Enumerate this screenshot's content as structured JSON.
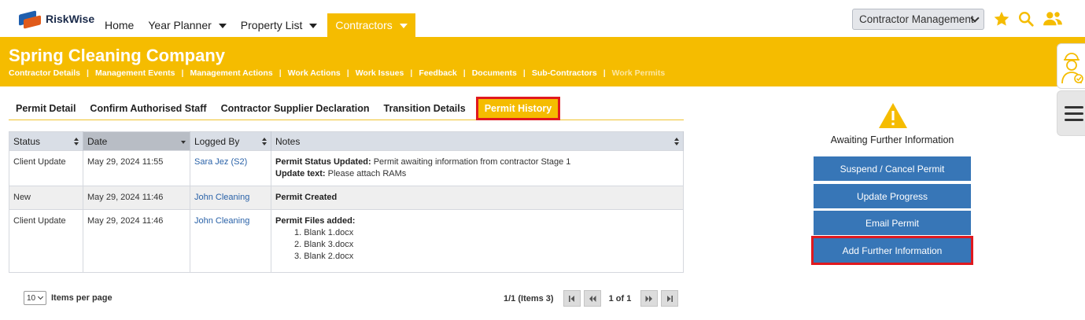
{
  "app": {
    "name": "RiskWise"
  },
  "nav": {
    "items": [
      {
        "label": "Home",
        "dropdown": false
      },
      {
        "label": "Year Planner",
        "dropdown": true
      },
      {
        "label": "Property List",
        "dropdown": true
      }
    ],
    "active": {
      "label": "Contractors",
      "dropdown": true
    }
  },
  "module_select": {
    "value": "Contractor Management"
  },
  "header": {
    "company": "Spring Cleaning Company",
    "subnav": [
      "Contractor Details",
      "Management Events",
      "Management Actions",
      "Work Actions",
      "Work Issues",
      "Feedback",
      "Documents",
      "Sub-Contractors"
    ],
    "subnav_dim": "Work Permits"
  },
  "tabs": [
    "Permit Detail",
    "Confirm Authorised Staff",
    "Contractor Supplier Declaration",
    "Transition Details"
  ],
  "active_tab": "Permit History",
  "table": {
    "headers": {
      "status": "Status",
      "date": "Date",
      "logged_by": "Logged By",
      "notes": "Notes"
    },
    "rows": [
      {
        "status": "Client Update",
        "date": "May 29, 2024 11:55",
        "logged_by": "Sara Jez (S2)",
        "note1_label": "Permit Status Updated:",
        "note1_text": " Permit awaiting information from contractor Stage 1",
        "note2_label": "Update text:",
        "note2_text": " Please attach RAMs"
      },
      {
        "status": "New",
        "date": "May 29, 2024 11:46",
        "logged_by": "John Cleaning",
        "note1_label": "Permit Created"
      },
      {
        "status": "Client Update",
        "date": "May 29, 2024 11:46",
        "logged_by": "John Cleaning",
        "note1_label": "Permit Files added:",
        "files": [
          "1. Blank 1.docx",
          "2. Blank 3.docx",
          "3. Blank 2.docx"
        ]
      }
    ]
  },
  "pager": {
    "page_size": "10",
    "page_size_label": "Items per page",
    "summary": "1/1 (Items 3)",
    "page_of": "1 of 1"
  },
  "side_panel": {
    "status": "Awaiting Further Information",
    "buttons": [
      "Suspend / Cancel Permit",
      "Update Progress",
      "Email Permit",
      "Add Further Information"
    ]
  },
  "colors": {
    "brand_yellow": "#f5bc00",
    "button_blue": "#3776b7",
    "highlight_red": "#e0191e"
  }
}
